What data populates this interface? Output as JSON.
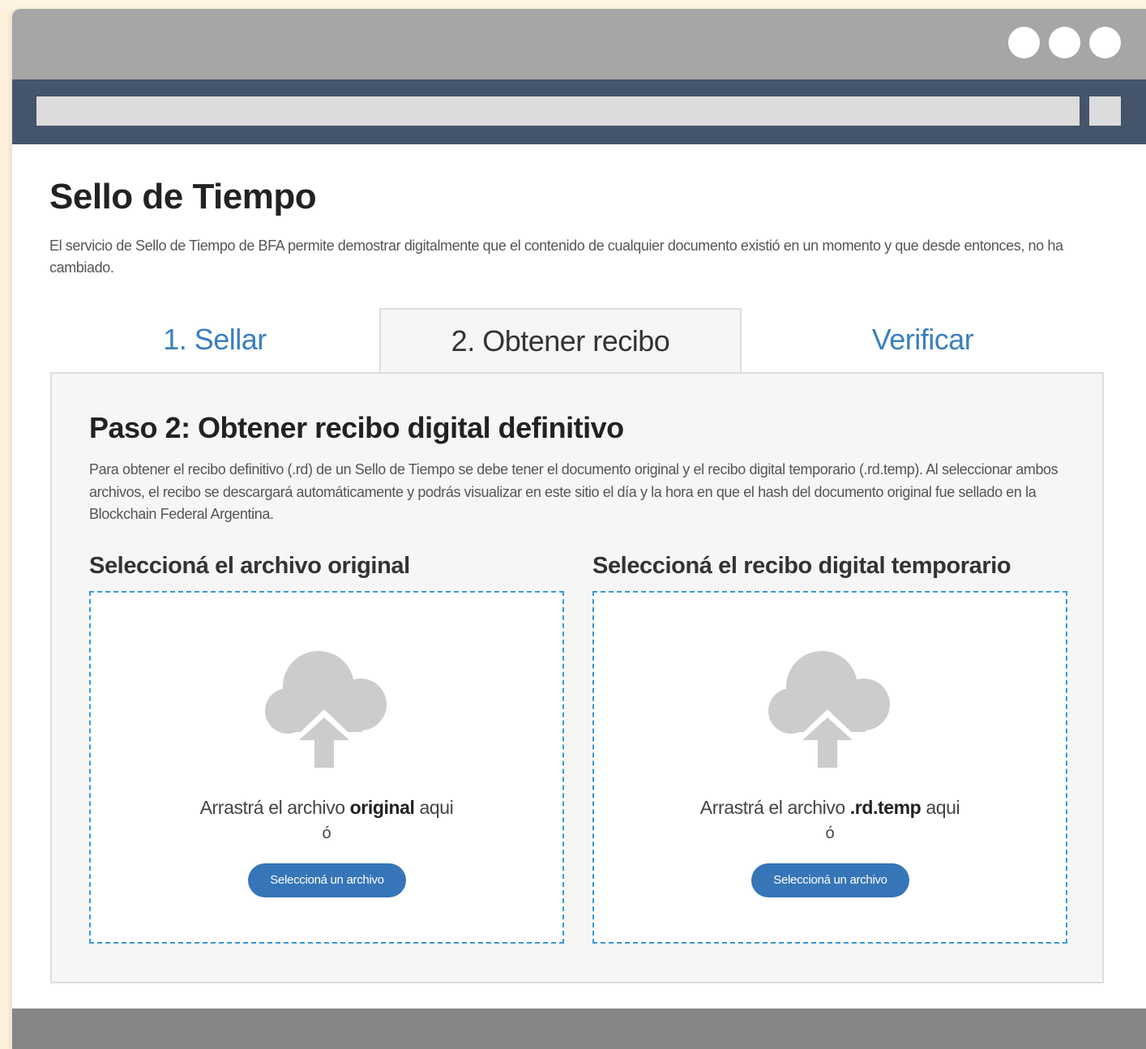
{
  "page": {
    "title": "Sello de Tiempo",
    "intro": "El servicio de Sello de Tiempo de BFA permite demostrar digitalmente que el contenido de cualquier documento existió en un momento y que desde entonces, no ha cambiado."
  },
  "tabs": [
    {
      "label": "1. Sellar",
      "active": false
    },
    {
      "label": "2. Obtener recibo",
      "active": true
    },
    {
      "label": "Verificar",
      "active": false
    }
  ],
  "panel": {
    "title": "Paso 2: Obtener recibo digital definitivo",
    "description": "Para obtener el recibo definitivo (.rd) de un Sello de Tiempo se debe tener el documento original y el recibo digital temporario (.rd.temp). Al seleccionar ambos archivos, el recibo se descargará automáticamente y podrás visualizar en este sitio el día y la hora en que el hash del documento original fue sellado en la Blockchain Federal Argentina."
  },
  "dropzones": [
    {
      "label": "Seleccioná el archivo original",
      "text_before": "Arrastrá el archivo ",
      "text_bold": "original",
      "text_after": " aqui",
      "or": "ó",
      "button": "Seleccioná un archivo",
      "icon": "cloud-upload-icon"
    },
    {
      "label": "Seleccioná el recibo digital temporario",
      "text_before": "Arrastrá el archivo ",
      "text_bold": ".rd.temp",
      "text_after": " aqui",
      "or": "ó",
      "button": "Seleccioná un archivo",
      "icon": "cloud-upload-icon"
    }
  ],
  "colors": {
    "accent": "#3a7fbf",
    "button": "#3575b8",
    "dropzone_border": "#3a9ad9",
    "navbar": "#44546a",
    "titlebar": "#a6a6a6"
  }
}
